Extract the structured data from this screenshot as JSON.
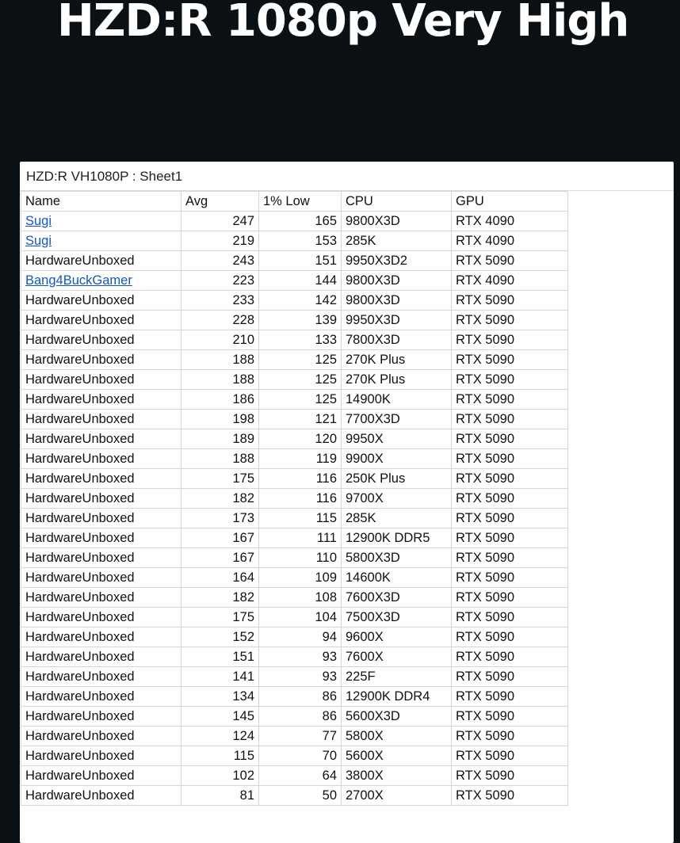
{
  "page": {
    "title": "HZD:R 1080p Very High"
  },
  "sheet": {
    "header": "HZD:R VH1080P : Sheet1",
    "columns": [
      "Name",
      "Avg",
      "1% Low",
      "CPU",
      "GPU"
    ],
    "rows": [
      {
        "name": "Sugi",
        "link": true,
        "avg": "247",
        "low": "165",
        "cpu": "9800X3D",
        "gpu": "RTX 4090"
      },
      {
        "name": "Sugi",
        "link": true,
        "avg": "219",
        "low": "153",
        "cpu": "285K",
        "gpu": "RTX 4090"
      },
      {
        "name": "HardwareUnboxed",
        "link": false,
        "avg": "243",
        "low": "151",
        "cpu": "9950X3D2",
        "gpu": "RTX 5090"
      },
      {
        "name": "Bang4BuckGamer",
        "link": true,
        "avg": "223",
        "low": "144",
        "cpu": "9800X3D",
        "gpu": "RTX 4090"
      },
      {
        "name": "HardwareUnboxed",
        "link": false,
        "avg": "233",
        "low": "142",
        "cpu": "9800X3D",
        "gpu": "RTX 5090"
      },
      {
        "name": "HardwareUnboxed",
        "link": false,
        "avg": "228",
        "low": "139",
        "cpu": "9950X3D",
        "gpu": "RTX 5090"
      },
      {
        "name": "HardwareUnboxed",
        "link": false,
        "avg": "210",
        "low": "133",
        "cpu": "7800X3D",
        "gpu": "RTX 5090"
      },
      {
        "name": "HardwareUnboxed",
        "link": false,
        "avg": "188",
        "low": "125",
        "cpu": "270K Plus",
        "gpu": "RTX 5090"
      },
      {
        "name": "HardwareUnboxed",
        "link": false,
        "avg": "188",
        "low": "125",
        "cpu": "270K Plus",
        "gpu": "RTX 5090"
      },
      {
        "name": "HardwareUnboxed",
        "link": false,
        "avg": "186",
        "low": "125",
        "cpu": "14900K",
        "gpu": "RTX 5090"
      },
      {
        "name": "HardwareUnboxed",
        "link": false,
        "avg": "198",
        "low": "121",
        "cpu": "7700X3D",
        "gpu": "RTX 5090"
      },
      {
        "name": "HardwareUnboxed",
        "link": false,
        "avg": "189",
        "low": "120",
        "cpu": "9950X",
        "gpu": "RTX 5090"
      },
      {
        "name": "HardwareUnboxed",
        "link": false,
        "avg": "188",
        "low": "119",
        "cpu": "9900X",
        "gpu": "RTX 5090"
      },
      {
        "name": "HardwareUnboxed",
        "link": false,
        "avg": "175",
        "low": "116",
        "cpu": "250K Plus",
        "gpu": "RTX 5090"
      },
      {
        "name": "HardwareUnboxed",
        "link": false,
        "avg": "182",
        "low": "116",
        "cpu": "9700X",
        "gpu": "RTX 5090"
      },
      {
        "name": "HardwareUnboxed",
        "link": false,
        "avg": "173",
        "low": "115",
        "cpu": "285K",
        "gpu": "RTX 5090"
      },
      {
        "name": "HardwareUnboxed",
        "link": false,
        "avg": "167",
        "low": "111",
        "cpu": "12900K DDR5",
        "gpu": "RTX 5090"
      },
      {
        "name": "HardwareUnboxed",
        "link": false,
        "avg": "167",
        "low": "110",
        "cpu": "5800X3D",
        "gpu": "RTX 5090"
      },
      {
        "name": "HardwareUnboxed",
        "link": false,
        "avg": "164",
        "low": "109",
        "cpu": "14600K",
        "gpu": "RTX 5090"
      },
      {
        "name": "HardwareUnboxed",
        "link": false,
        "avg": "182",
        "low": "108",
        "cpu": "7600X3D",
        "gpu": "RTX 5090"
      },
      {
        "name": "HardwareUnboxed",
        "link": false,
        "avg": "175",
        "low": "104",
        "cpu": "7500X3D",
        "gpu": "RTX 5090"
      },
      {
        "name": "HardwareUnboxed",
        "link": false,
        "avg": "152",
        "low": "94",
        "cpu": "9600X",
        "gpu": "RTX 5090"
      },
      {
        "name": "HardwareUnboxed",
        "link": false,
        "avg": "151",
        "low": "93",
        "cpu": "7600X",
        "gpu": "RTX 5090"
      },
      {
        "name": "HardwareUnboxed",
        "link": false,
        "avg": "141",
        "low": "93",
        "cpu": "225F",
        "gpu": "RTX 5090"
      },
      {
        "name": "HardwareUnboxed",
        "link": false,
        "avg": "134",
        "low": "86",
        "cpu": "12900K DDR4",
        "gpu": "RTX 5090"
      },
      {
        "name": "HardwareUnboxed",
        "link": false,
        "avg": "145",
        "low": "86",
        "cpu": "5600X3D",
        "gpu": "RTX 5090"
      },
      {
        "name": "HardwareUnboxed",
        "link": false,
        "avg": "124",
        "low": "77",
        "cpu": "5800X",
        "gpu": "RTX 5090"
      },
      {
        "name": "HardwareUnboxed",
        "link": false,
        "avg": "115",
        "low": "70",
        "cpu": "5600X",
        "gpu": "RTX 5090"
      },
      {
        "name": "HardwareUnboxed",
        "link": false,
        "avg": "102",
        "low": "64",
        "cpu": "3800X",
        "gpu": "RTX 5090"
      },
      {
        "name": "HardwareUnboxed",
        "link": false,
        "avg": "81",
        "low": "50",
        "cpu": "2700X",
        "gpu": "RTX 5090"
      }
    ]
  }
}
